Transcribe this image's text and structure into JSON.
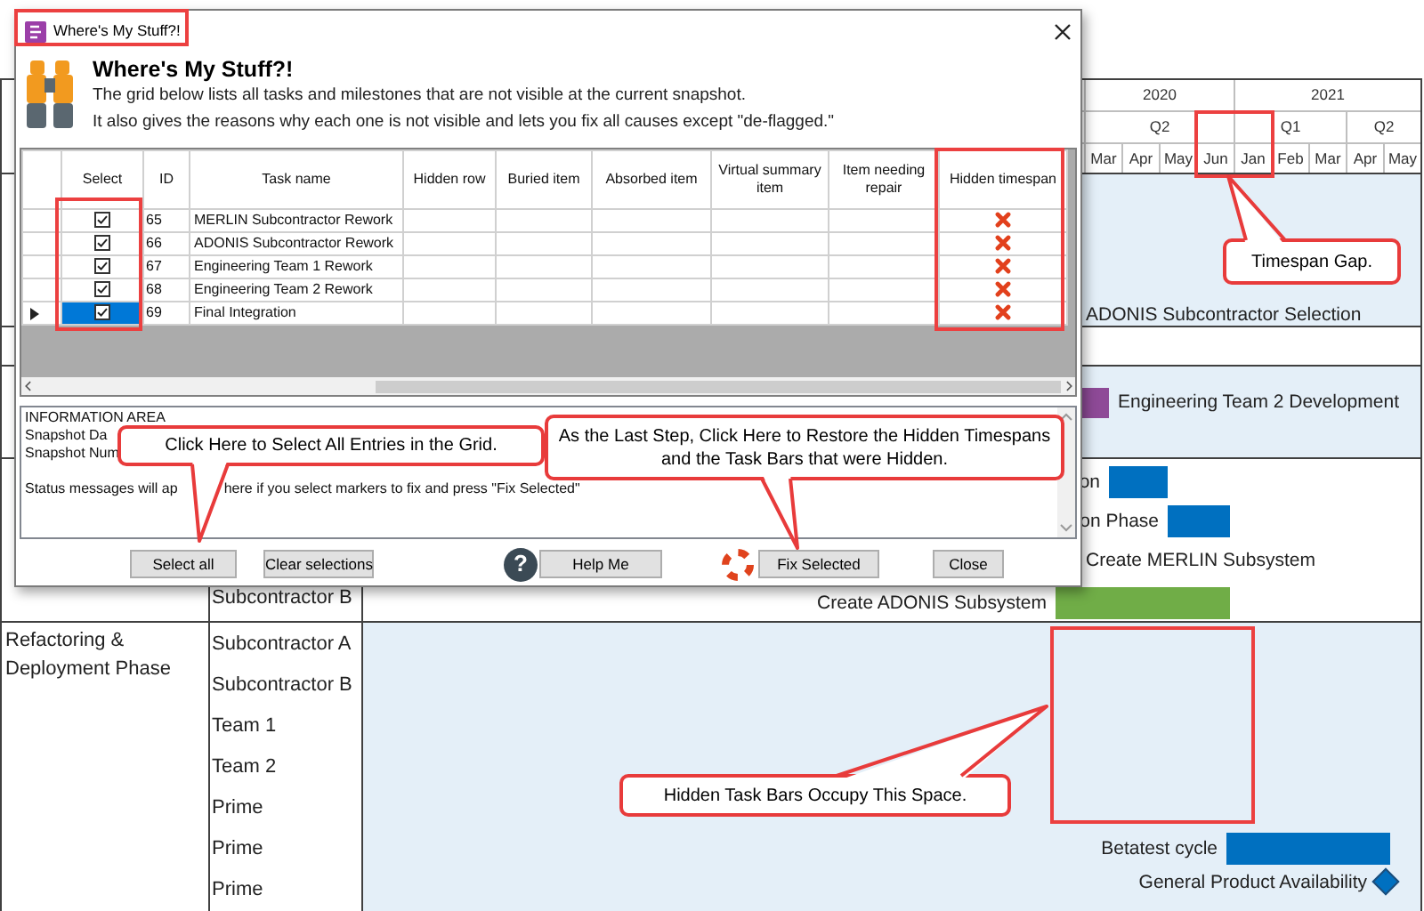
{
  "dialog": {
    "title": "Where's My Stuff?!",
    "heading": "Where's My Stuff?!",
    "description": [
      "The grid below lists all tasks and milestones that are not visible at the current snapshot.",
      "It also gives the reasons why each one is not visible and lets you fix all causes except \"de-flagged.\""
    ],
    "grid": {
      "columns": [
        "Select",
        "ID",
        "Task name",
        "Hidden row",
        "Buried item",
        "Absorbed item",
        "Virtual summary item",
        "Item needing repair",
        "Hidden timespan"
      ],
      "rows": [
        {
          "id": "65",
          "task": "MERLIN Subcontractor Rework",
          "checked": true,
          "selected": false,
          "current": false,
          "hidden_timespan": true
        },
        {
          "id": "66",
          "task": "ADONIS Subcontractor Rework",
          "checked": true,
          "selected": false,
          "current": false,
          "hidden_timespan": true
        },
        {
          "id": "67",
          "task": "Engineering Team 1 Rework",
          "checked": true,
          "selected": false,
          "current": false,
          "hidden_timespan": true
        },
        {
          "id": "68",
          "task": "Engineering Team 2 Rework",
          "checked": true,
          "selected": false,
          "current": false,
          "hidden_timespan": true
        },
        {
          "id": "69",
          "task": "Final Integration",
          "checked": true,
          "selected": true,
          "current": true,
          "hidden_timespan": true
        }
      ]
    },
    "info_area": {
      "heading": "INFORMATION AREA",
      "lines": [
        "Snapshot Da",
        "Snapshot Num"
      ],
      "status": [
        "Status messages will ap",
        "here if you select markers to fix and press \"Fix Selected\""
      ]
    },
    "help_glyph": "?",
    "buttons": [
      "Select all",
      "Clear selections",
      "Help Me",
      "Fix Selected",
      "Close"
    ]
  },
  "gantt": {
    "years": [
      "2020",
      "2021"
    ],
    "quarters": [
      "Q2",
      "Q1",
      "Q2"
    ],
    "months": [
      "Mar",
      "Apr",
      "May",
      "Jun",
      "Jan",
      "Feb",
      "Mar",
      "Apr",
      "May"
    ],
    "bands": [
      {
        "shaded": true,
        "items": [
          {
            "kind": "label",
            "label": "ADONIS Subcontractor Selection"
          }
        ]
      },
      {
        "shaded": false
      },
      {
        "shaded": true,
        "items": [
          {
            "kind": "bar",
            "label": "Engineering Team 2 Development",
            "color": "#8e4a97"
          }
        ]
      },
      {
        "shaded": false,
        "resources": [
          "Subcontractor B"
        ],
        "items": [
          {
            "kind": "bar",
            "label": "on",
            "color": "#0070c0"
          },
          {
            "kind": "bar",
            "label": "on Phase",
            "color": "#0070c0"
          },
          {
            "kind": "label",
            "label": "Create MERLIN Subsystem"
          },
          {
            "kind": "bar",
            "label": "Create ADONIS Subsystem",
            "color": "#70ad47"
          }
        ]
      },
      {
        "shaded": true,
        "phase": "Refactoring & Deployment Phase",
        "resources": [
          "Subcontractor A",
          "Subcontractor B",
          "Team 1",
          "Team 2",
          "Prime",
          "Prime",
          "Prime"
        ],
        "items": [
          {
            "kind": "bar",
            "label": "Betatest cycle",
            "color": "#0070c0"
          },
          {
            "kind": "milestone",
            "label": "General Product Availability",
            "color": "#0070c0"
          }
        ]
      }
    ]
  },
  "callouts": [
    "Click Here to Select All Entries in the Grid.",
    "As the Last Step, Click Here to Restore the Hidden Timespans and the Task Bars that were Hidden.",
    "Timespan Gap.",
    "Hidden Task Bars Occupy This Space."
  ]
}
